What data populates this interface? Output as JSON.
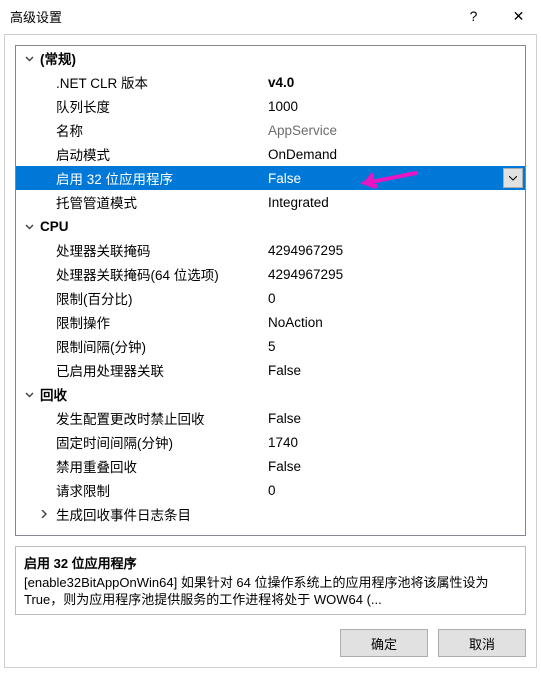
{
  "window": {
    "title": "高级设置",
    "help": "?",
    "close": "✕"
  },
  "categories": [
    {
      "name": "(常规)",
      "props": [
        {
          "label": ".NET CLR 版本",
          "value": "v4.0",
          "bold": true
        },
        {
          "label": "队列长度",
          "value": "1000"
        },
        {
          "label": "名称",
          "value": "AppService",
          "grey": true
        },
        {
          "label": "启动模式",
          "value": "OnDemand"
        },
        {
          "label": "启用 32 位应用程序",
          "value": "False",
          "selected": true,
          "dropdown": true,
          "arrow": true
        },
        {
          "label": "托管管道模式",
          "value": "Integrated"
        }
      ]
    },
    {
      "name": "CPU",
      "props": [
        {
          "label": "处理器关联掩码",
          "value": "4294967295"
        },
        {
          "label": "处理器关联掩码(64 位选项)",
          "value": "4294967295"
        },
        {
          "label": "限制(百分比)",
          "value": "0"
        },
        {
          "label": "限制操作",
          "value": "NoAction"
        },
        {
          "label": "限制间隔(分钟)",
          "value": "5"
        },
        {
          "label": "已启用处理器关联",
          "value": "False"
        }
      ]
    },
    {
      "name": "回收",
      "props": [
        {
          "label": "发生配置更改时禁止回收",
          "value": "False"
        },
        {
          "label": "固定时间间隔(分钟)",
          "value": "1740"
        },
        {
          "label": "禁用重叠回收",
          "value": "False"
        },
        {
          "label": "请求限制",
          "value": "0"
        },
        {
          "label": "生成回收事件日志条目",
          "value": "",
          "expandable": true
        }
      ]
    }
  ],
  "description": {
    "title": "启用 32 位应用程序",
    "text": "[enable32BitAppOnWin64] 如果针对 64 位操作系统上的应用程序池将该属性设为 True，则为应用程序池提供服务的工作进程将处于 WOW64 (..."
  },
  "buttons": {
    "ok": "确定",
    "cancel": "取消"
  }
}
